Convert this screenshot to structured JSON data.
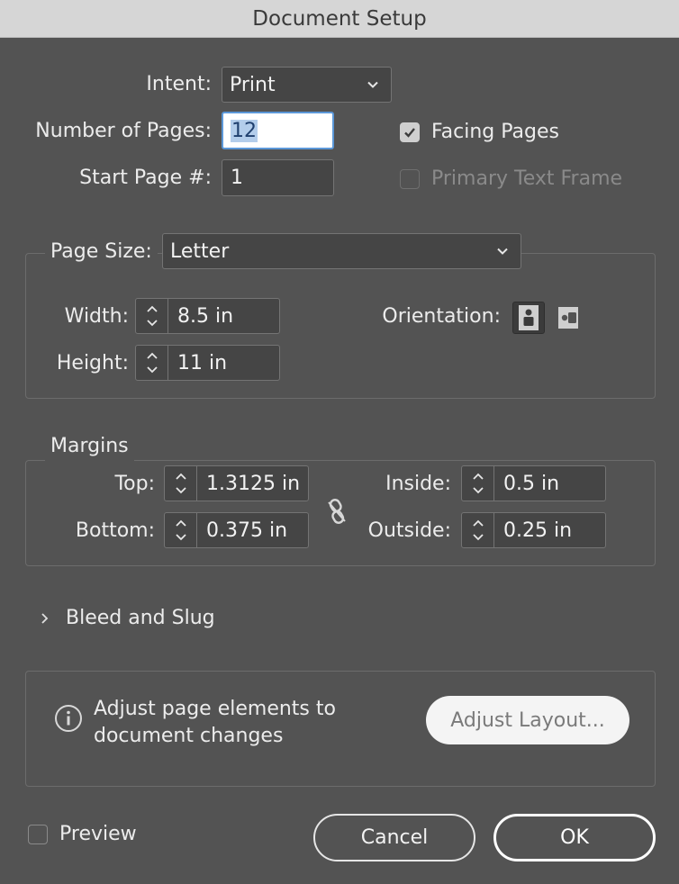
{
  "window": {
    "title": "Document Setup"
  },
  "intent": {
    "label": "Intent:",
    "value": "Print"
  },
  "pages": {
    "label": "Number of Pages:",
    "value": "12"
  },
  "start_page": {
    "label": "Start Page #:",
    "value": "1"
  },
  "facing_pages": {
    "label": "Facing Pages",
    "checked": true
  },
  "primary_text_frame": {
    "label": "Primary Text Frame",
    "checked": false,
    "enabled": false
  },
  "page_size": {
    "label": "Page Size:",
    "value": "Letter",
    "width_label": "Width:",
    "width": "8.5 in",
    "height_label": "Height:",
    "height": "11 in",
    "orientation_label": "Orientation:",
    "orientation": "portrait"
  },
  "margins": {
    "title": "Margins",
    "top_label": "Top:",
    "top": "1.3125 in",
    "bottom_label": "Bottom:",
    "bottom": "0.375 in",
    "inside_label": "Inside:",
    "inside": "0.5 in",
    "outside_label": "Outside:",
    "outside": "0.25 in",
    "linked": false
  },
  "bleed": {
    "label": "Bleed and Slug"
  },
  "adjust": {
    "line1": "Adjust page elements to",
    "line2": "document changes",
    "button": "Adjust Layout..."
  },
  "preview": {
    "label": "Preview",
    "checked": false
  },
  "buttons": {
    "cancel": "Cancel",
    "ok": "OK"
  },
  "colors": {
    "background": "#535353",
    "focus": "#5b97d8",
    "field": "#454545"
  }
}
